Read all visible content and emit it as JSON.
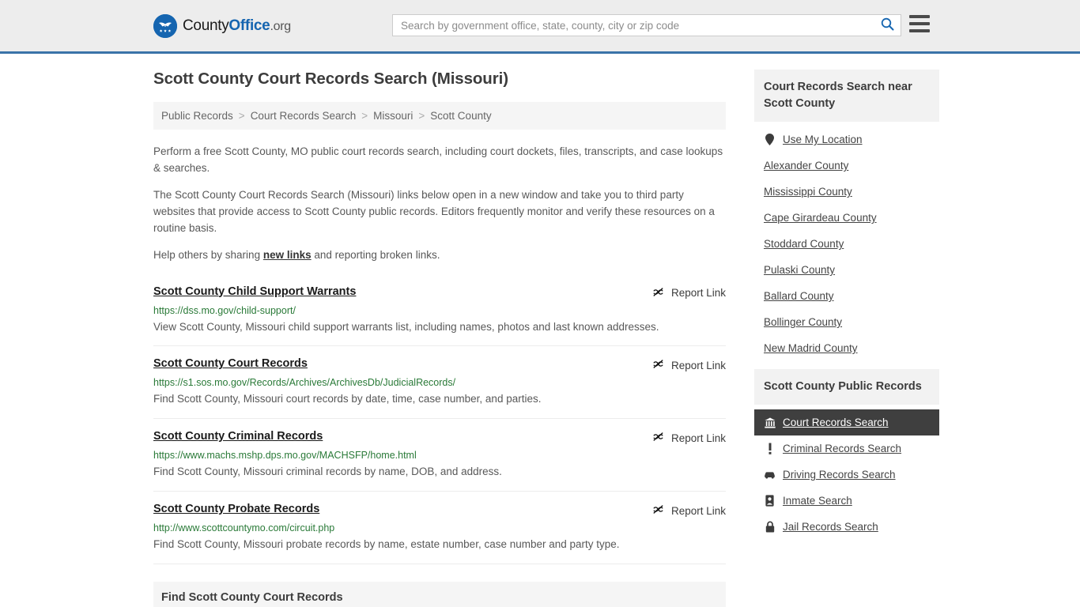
{
  "header": {
    "logo_text_1": "County",
    "logo_text_2": "Office",
    "logo_text_3": ".org",
    "search_placeholder": "Search by government office, state, county, city or zip code",
    "search_value": "",
    "search_icon": "search-icon",
    "menu_icon": "hamburger-menu-icon"
  },
  "page_title": "Scott County Court Records Search (Missouri)",
  "breadcrumb": {
    "separator": ">",
    "items": [
      {
        "label": "Public Records"
      },
      {
        "label": "Court Records Search"
      },
      {
        "label": "Missouri"
      },
      {
        "label": "Scott County"
      }
    ]
  },
  "intro": {
    "p1": "Perform a free Scott County, MO public court records search, including court dockets, files, transcripts, and case lookups & searches.",
    "p2": "The Scott County Court Records Search (Missouri) links below open in a new window and take you to third party websites that provide access to Scott County public records. Editors frequently monitor and verify these resources on a routine basis.",
    "p3_before": "Help others by sharing ",
    "p3_link": "new links",
    "p3_after": " and reporting broken links."
  },
  "report_link_label": "Report Link",
  "results": [
    {
      "title": "Scott County Child Support Warrants",
      "url": "https://dss.mo.gov/child-support/",
      "description": "View Scott County, Missouri child support warrants list, including names, photos and last known addresses."
    },
    {
      "title": "Scott County Court Records",
      "url": "https://s1.sos.mo.gov/Records/Archives/ArchivesDb/JudicialRecords/",
      "description": "Find Scott County, Missouri court records by date, time, case number, and parties."
    },
    {
      "title": "Scott County Criminal Records",
      "url": "https://www.machs.mshp.dps.mo.gov/MACHSFP/home.html",
      "description": "Find Scott County, Missouri criminal records by name, DOB, and address."
    },
    {
      "title": "Scott County Probate Records",
      "url": "http://www.scottcountymo.com/circuit.php",
      "description": "Find Scott County, Missouri probate records by name, estate number, case number and party type."
    }
  ],
  "section_heading": "Find Scott County Court Records",
  "sidebar": {
    "nearby_panel": {
      "title": "Court Records Search near Scott County",
      "items": [
        {
          "label": "Use My Location",
          "icon": "map-pin-icon"
        },
        {
          "label": "Alexander County",
          "icon": ""
        },
        {
          "label": "Mississippi County",
          "icon": ""
        },
        {
          "label": "Cape Girardeau County",
          "icon": ""
        },
        {
          "label": "Stoddard County",
          "icon": ""
        },
        {
          "label": "Pulaski County",
          "icon": ""
        },
        {
          "label": "Ballard County",
          "icon": ""
        },
        {
          "label": "Bollinger County",
          "icon": ""
        },
        {
          "label": "New Madrid County",
          "icon": ""
        }
      ]
    },
    "records_panel": {
      "title": "Scott County Public Records",
      "items": [
        {
          "label": "Court Records Search",
          "icon": "courthouse-icon",
          "active": true
        },
        {
          "label": "Criminal Records Search",
          "icon": "exclamation-icon",
          "active": false
        },
        {
          "label": "Driving Records Search",
          "icon": "car-icon",
          "active": false
        },
        {
          "label": "Inmate Search",
          "icon": "id-card-icon",
          "active": false
        },
        {
          "label": "Jail Records Search",
          "icon": "lock-icon",
          "active": false
        }
      ]
    }
  },
  "colors": {
    "brand_blue": "#1565b0",
    "header_border": "#3a73a8",
    "url_green": "#2a7a38",
    "active_bg": "#3f3f3f",
    "panel_bg": "#f2f2f2"
  }
}
